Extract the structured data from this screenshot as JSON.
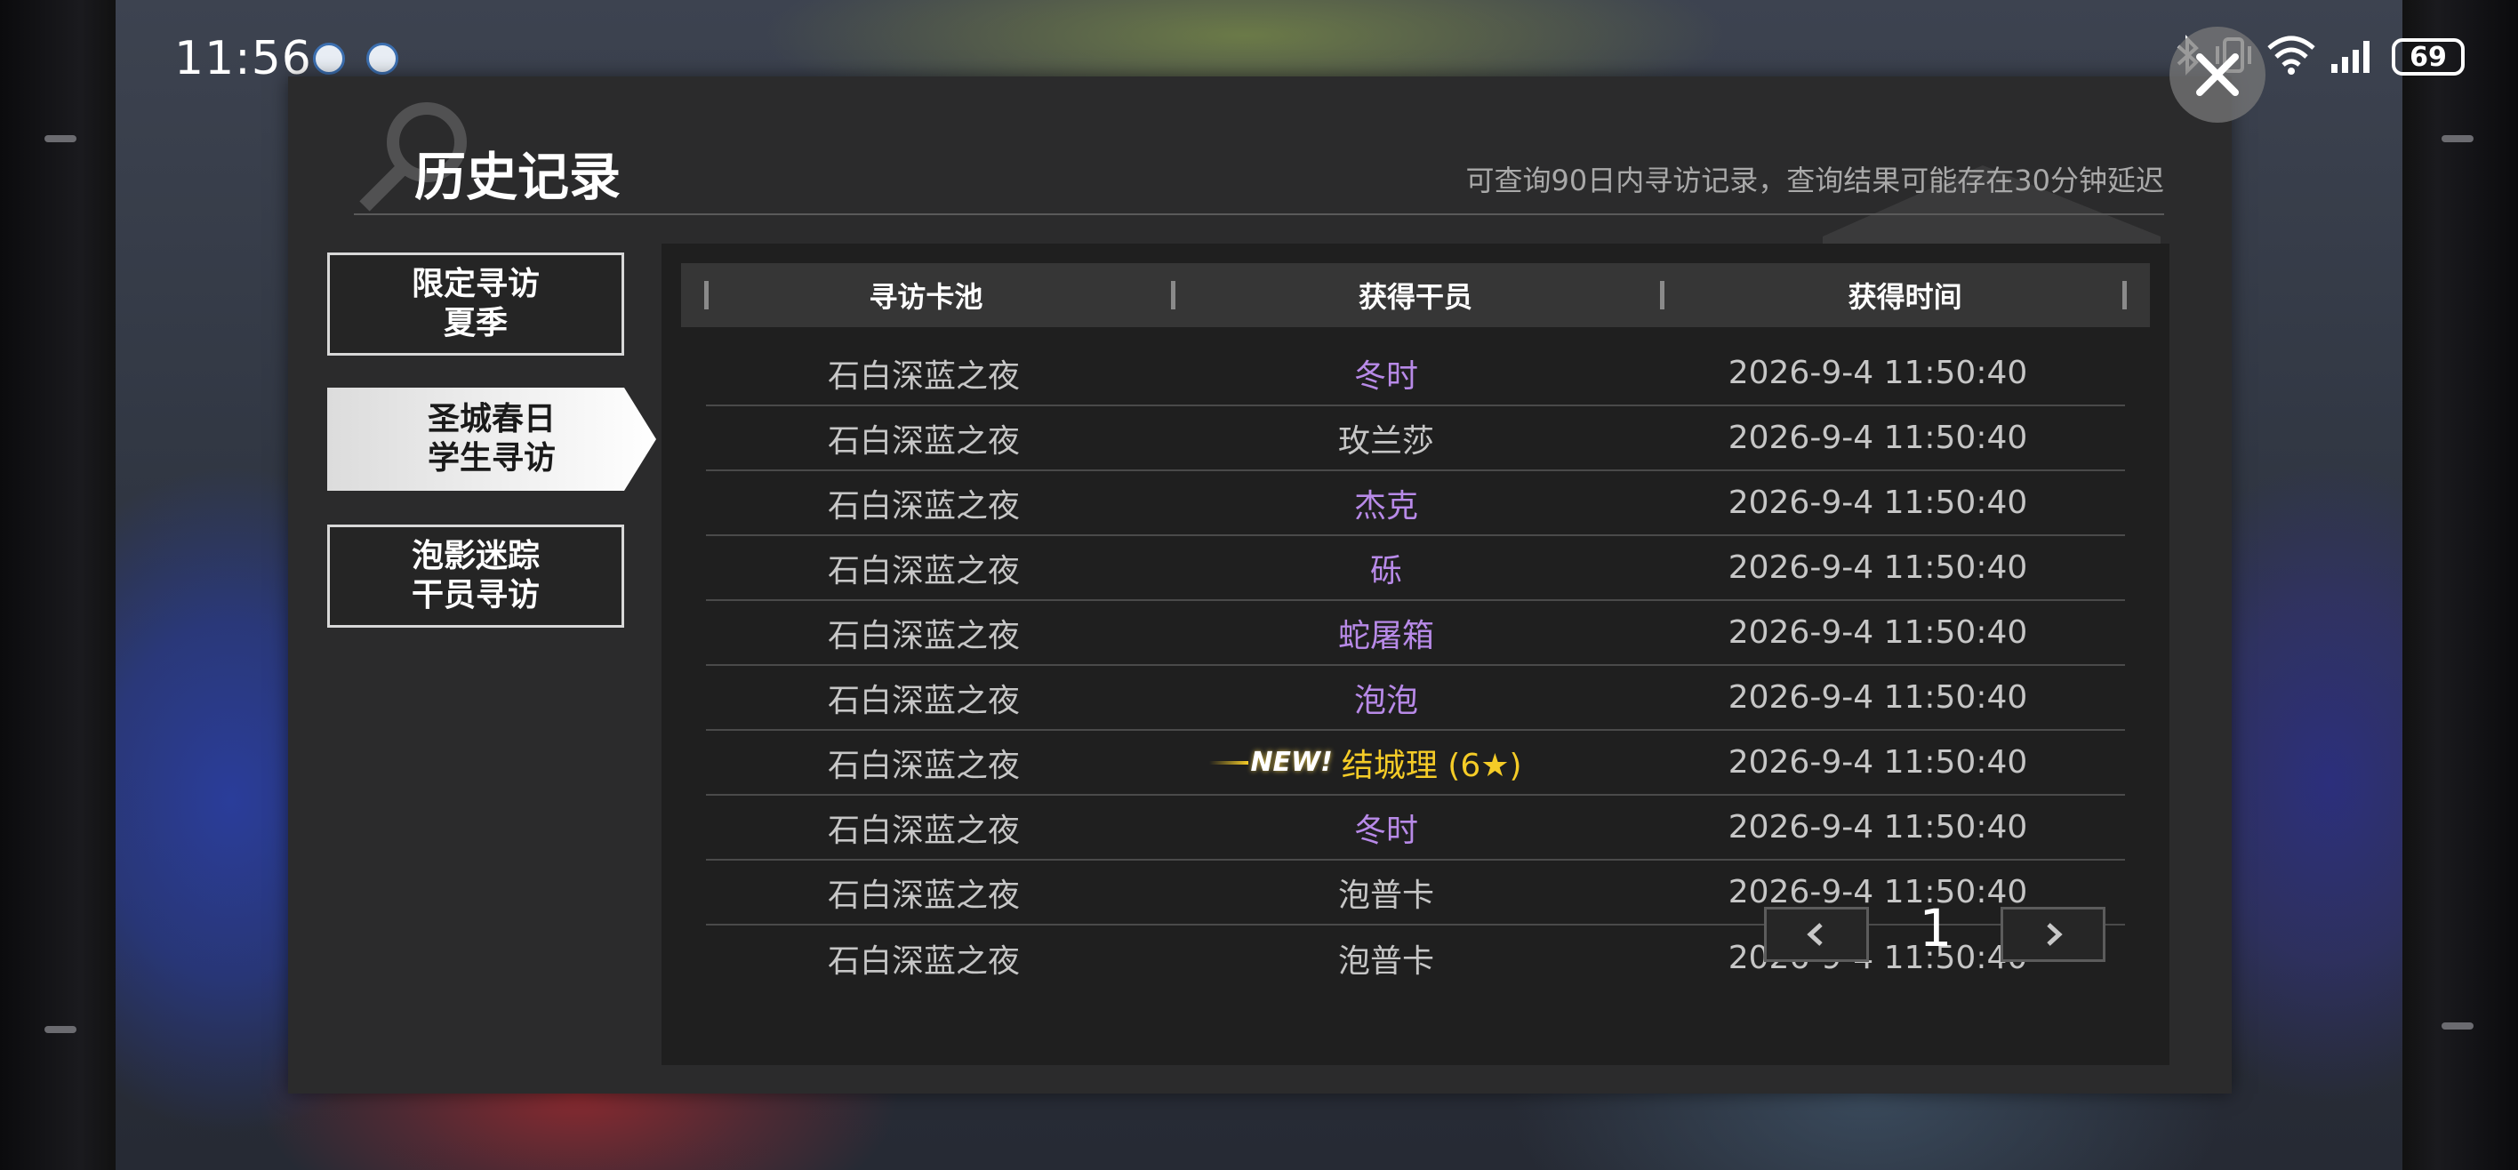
{
  "status_bar": {
    "time": "11:56",
    "battery": "69"
  },
  "dialog": {
    "title": "历史记录",
    "notice": "可查询90日内寻访记录，查询结果可能存在30分钟延迟"
  },
  "tabs": [
    {
      "line1": "限定寻访",
      "line2": "夏季",
      "active": false
    },
    {
      "line1": "圣城春日",
      "line2": "学生寻访",
      "active": true
    },
    {
      "line1": "泡影迷踪",
      "line2": "干员寻访",
      "active": false
    }
  ],
  "table": {
    "headers": [
      "寻访卡池",
      "获得干员",
      "获得时间"
    ],
    "rows": [
      {
        "pool": "石白深蓝之夜",
        "operator": "冬时",
        "rarity": "purple",
        "time": "2026-9-4 11:50:40"
      },
      {
        "pool": "石白深蓝之夜",
        "operator": "玫兰莎",
        "rarity": "grey",
        "time": "2026-9-4 11:50:40"
      },
      {
        "pool": "石白深蓝之夜",
        "operator": "杰克",
        "rarity": "purple",
        "time": "2026-9-4 11:50:40"
      },
      {
        "pool": "石白深蓝之夜",
        "operator": "砾",
        "rarity": "purple",
        "time": "2026-9-4 11:50:40"
      },
      {
        "pool": "石白深蓝之夜",
        "operator": "蛇屠箱",
        "rarity": "purple",
        "time": "2026-9-4 11:50:40"
      },
      {
        "pool": "石白深蓝之夜",
        "operator": "泡泡",
        "rarity": "purple",
        "time": "2026-9-4 11:50:40"
      },
      {
        "pool": "石白深蓝之夜",
        "operator": "结城理 (6★)",
        "rarity": "gold",
        "is_new": true,
        "new_label": "NEW!",
        "time": "2026-9-4 11:50:40"
      },
      {
        "pool": "石白深蓝之夜",
        "operator": "冬时",
        "rarity": "purple",
        "time": "2026-9-4 11:50:40"
      },
      {
        "pool": "石白深蓝之夜",
        "operator": "泡普卡",
        "rarity": "grey",
        "time": "2026-9-4 11:50:40"
      },
      {
        "pool": "石白深蓝之夜",
        "operator": "泡普卡",
        "rarity": "grey",
        "time": "2026-9-4 11:50:40"
      }
    ]
  },
  "pagination": {
    "current_page": "1",
    "prev_icon": "chevron-left-icon",
    "next_icon": "chevron-right-icon"
  },
  "colors": {
    "purple_rarity": "#b88ae8",
    "gold_rarity": "#f5cc27",
    "grey_rarity": "#c6c6c6",
    "dialog_bg": "#2b2b2c",
    "panel_bg": "#1f1f1f"
  }
}
